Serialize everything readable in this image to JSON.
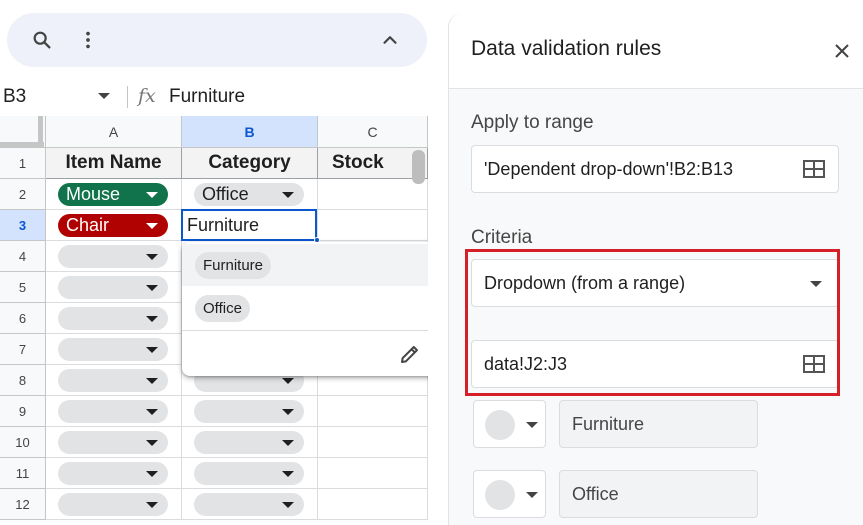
{
  "toolbar": {
    "search_icon": "search-icon",
    "more_icon": "more-vert-icon",
    "collapse_icon": "chevron-up-icon"
  },
  "formula_bar": {
    "name_box": "B3",
    "fx_label": "fx",
    "value": "Furniture"
  },
  "grid": {
    "columns": [
      "A",
      "B",
      "C"
    ],
    "selected_column": "B",
    "rows": [
      "1",
      "2",
      "3",
      "4",
      "5",
      "6",
      "7",
      "8",
      "9",
      "10",
      "11",
      "12"
    ],
    "selected_row": "3",
    "header_row": [
      "Item Name",
      "Category",
      "Stock"
    ],
    "row2": {
      "item": "Mouse",
      "category": "Office"
    },
    "row3": {
      "item": "Chair",
      "category": "Furniture"
    },
    "colors": {
      "mouse_chip": "#11734b",
      "chair_chip": "#b10202",
      "empty_chip": "#e1e3e5"
    }
  },
  "dropdown_popup": {
    "options": [
      "Furniture",
      "Office"
    ],
    "highlighted": "Furniture",
    "edit_icon": "pencil-icon"
  },
  "panel": {
    "title": "Data validation rules",
    "close_icon": "close-icon",
    "apply_label": "Apply to range",
    "range_value": "'Dependent drop-down'!B2:B13",
    "criteria_label": "Criteria",
    "criteria_type": "Dropdown (from a range)",
    "criteria_range": "data!J2:J3",
    "items": [
      "Furniture",
      "Office"
    ],
    "highlight_color": "#d5202a"
  }
}
